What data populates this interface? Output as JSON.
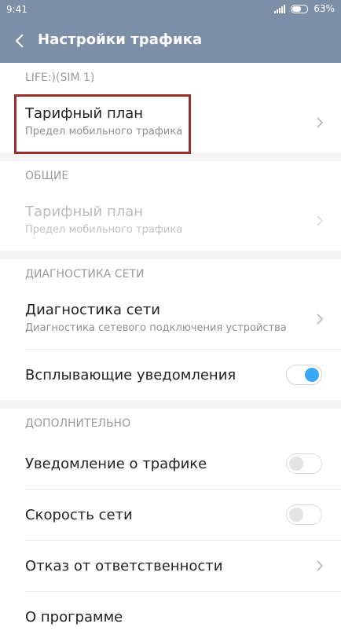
{
  "status_bar": {
    "time": "9:41",
    "battery": "63%",
    "battery_level": 0.63
  },
  "header": {
    "title": "Настройки трафика"
  },
  "sections": [
    {
      "header": "LIFE:)(SIM 1)",
      "items": [
        {
          "title": "Тарифный план",
          "subtitle": "Предел мобильного трафика"
        }
      ]
    },
    {
      "header": "ОБЩИЕ",
      "items": [
        {
          "title": "Тарифный план",
          "subtitle": "Предел мобильного трафика",
          "enabled": false
        }
      ]
    },
    {
      "header": "ДИАГНОСТИКА СЕТИ",
      "items": [
        {
          "title": "Диагностика сети",
          "subtitle": "Диагностика сетевого подключения устройства"
        },
        {
          "title": "Всплывающие уведомления",
          "toggle": true
        }
      ]
    },
    {
      "header": "ДОПОЛНИТЕЛЬНО",
      "items": [
        {
          "title": "Уведомление о трафике",
          "toggle": false
        },
        {
          "title": "Скорость сети",
          "toggle": false
        },
        {
          "title": "Отказ от ответственности"
        },
        {
          "title": "О программе"
        }
      ]
    }
  ],
  "colors": {
    "header_bg": "#7d8fa6",
    "accent": "#3ba6f5",
    "highlight": "#9b2d2d"
  }
}
